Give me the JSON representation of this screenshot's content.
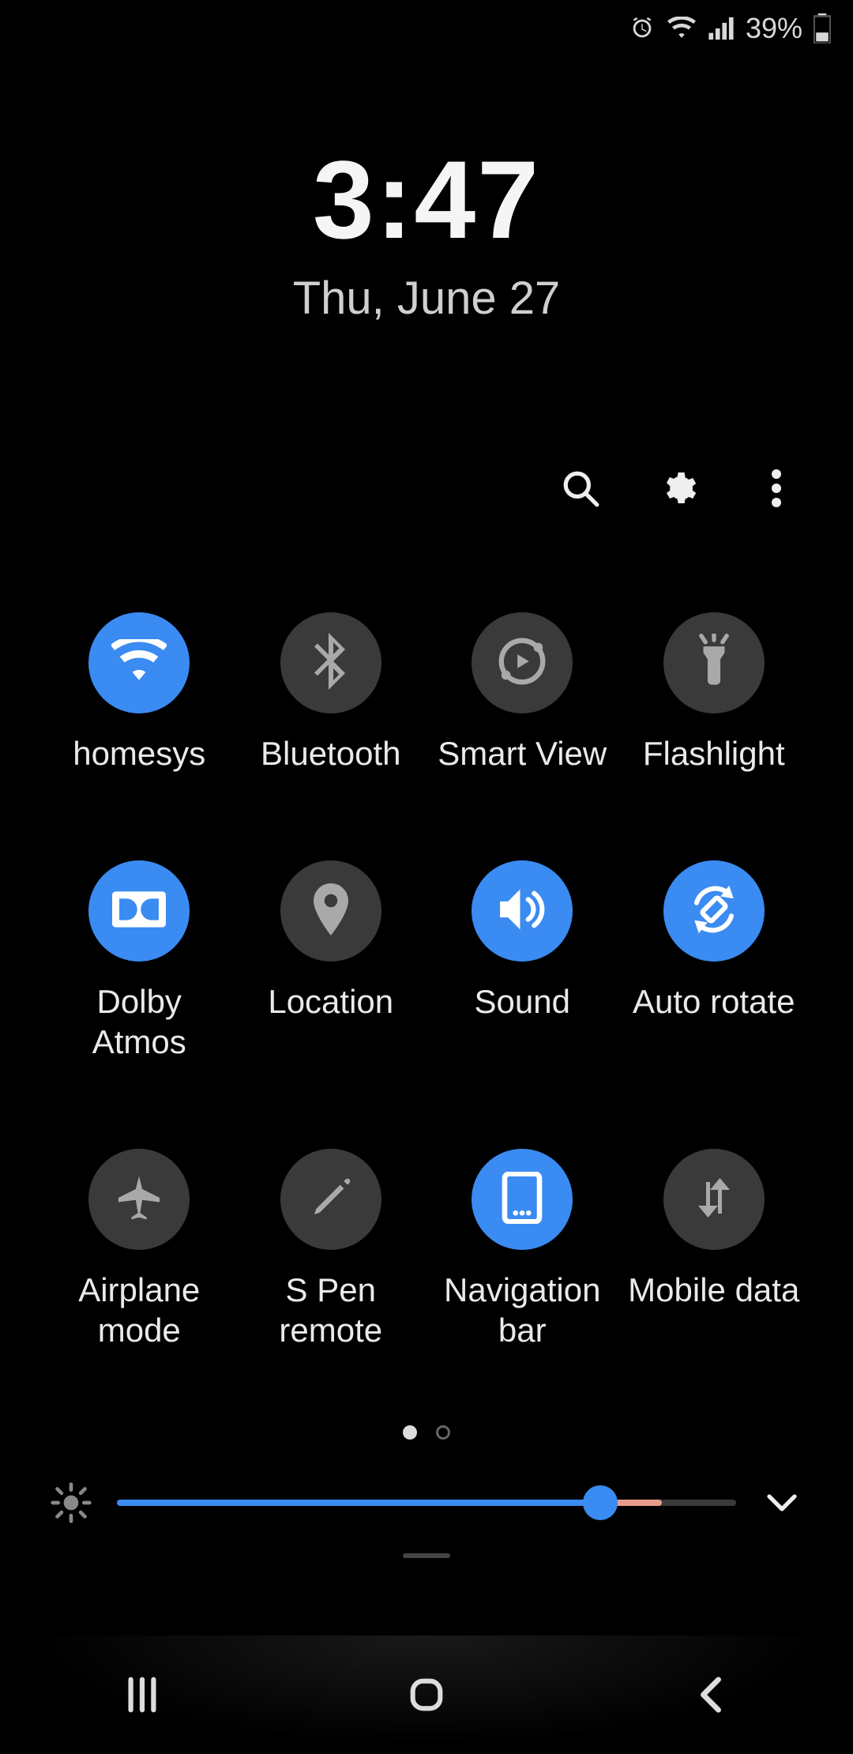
{
  "status": {
    "battery_text": "39%",
    "icons": [
      "alarm-icon",
      "wifi-icon",
      "signal-icon"
    ]
  },
  "clock": {
    "time": "3:47",
    "date": "Thu, June 27"
  },
  "actions": {
    "search": "search",
    "settings": "settings",
    "more": "more"
  },
  "tiles": [
    {
      "id": "wifi",
      "label": "homesys",
      "active": true
    },
    {
      "id": "bluetooth",
      "label": "Bluetooth",
      "active": false
    },
    {
      "id": "smartview",
      "label": "Smart View",
      "active": false
    },
    {
      "id": "flashlight",
      "label": "Flashlight",
      "active": false
    },
    {
      "id": "dolby",
      "label": "Dolby Atmos",
      "active": true
    },
    {
      "id": "location",
      "label": "Location",
      "active": false
    },
    {
      "id": "sound",
      "label": "Sound",
      "active": true
    },
    {
      "id": "autorotate",
      "label": "Auto rotate",
      "active": true
    },
    {
      "id": "airplane",
      "label": "Airplane mode",
      "active": false
    },
    {
      "id": "spen",
      "label": "S Pen remote",
      "active": false
    },
    {
      "id": "navbar",
      "label": "Navigation bar",
      "active": true
    },
    {
      "id": "mobiledata",
      "label": "Mobile data",
      "active": false
    }
  ],
  "pages": {
    "current": 1,
    "total": 2
  },
  "brightness": {
    "percent": 78,
    "warm_segment_end": 88
  },
  "colors": {
    "accent": "#3a8bf2",
    "inactive_tile": "#3a3a3a"
  }
}
